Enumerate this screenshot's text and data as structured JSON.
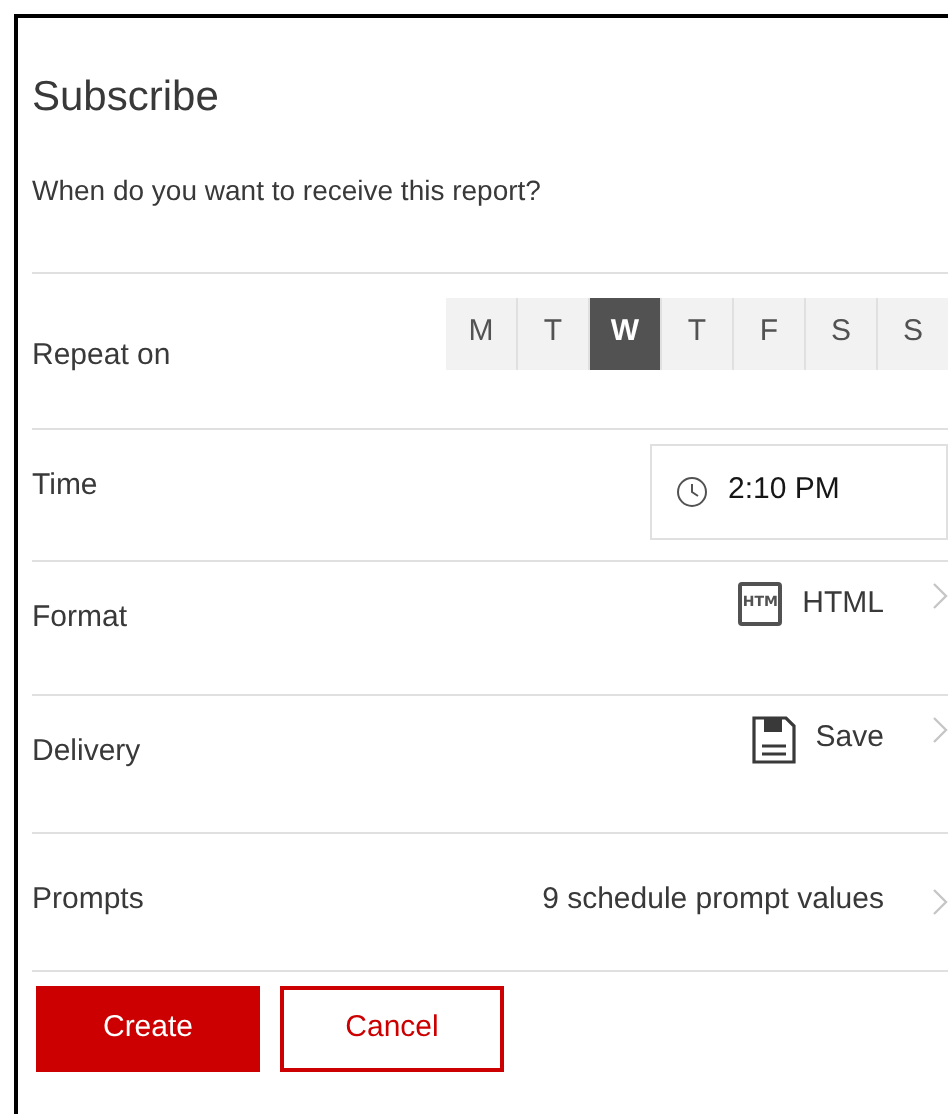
{
  "title": "Subscribe",
  "subtitle": "When do you want to receive this report?",
  "rows": [
    {
      "kind": "days",
      "label": "Repeat on",
      "days": [
        {
          "label": "M",
          "selected": false
        },
        {
          "label": "T",
          "selected": false
        },
        {
          "label": "W",
          "selected": true
        },
        {
          "label": "T",
          "selected": false
        },
        {
          "label": "F",
          "selected": false
        },
        {
          "label": "S",
          "selected": false
        },
        {
          "label": "S",
          "selected": false
        }
      ]
    },
    {
      "kind": "time",
      "label": "Time",
      "value": "2:10 PM"
    },
    {
      "kind": "format",
      "label": "Format",
      "value": "HTML",
      "icon_text": "HTM"
    },
    {
      "kind": "delivery",
      "label": "Delivery",
      "value": "Save"
    },
    {
      "kind": "prompts",
      "label": "Prompts",
      "value": "9 schedule prompt values"
    }
  ],
  "buttons": [
    {
      "label": "Create",
      "kind": "primary"
    },
    {
      "label": "Cancel",
      "kind": "secondary"
    }
  ]
}
